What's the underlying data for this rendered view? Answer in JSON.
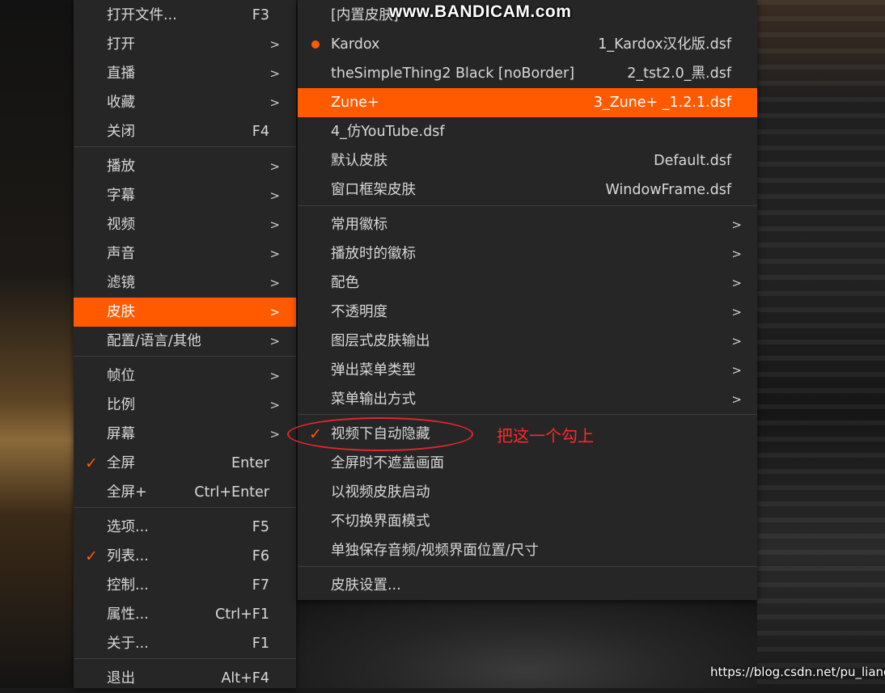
{
  "main_menu": {
    "items": [
      {
        "label": "打开文件...",
        "accel": "F3",
        "arrow": ""
      },
      {
        "label": "打开",
        "accel": "",
        "arrow": ">"
      },
      {
        "label": "直播",
        "accel": "",
        "arrow": ">"
      },
      {
        "label": "收藏",
        "accel": "",
        "arrow": ">"
      },
      {
        "label": "关闭",
        "accel": "F4",
        "arrow": ""
      },
      {
        "label": "播放",
        "accel": "",
        "arrow": ">"
      },
      {
        "label": "字幕",
        "accel": "",
        "arrow": ">"
      },
      {
        "label": "视频",
        "accel": "",
        "arrow": ">"
      },
      {
        "label": "声音",
        "accel": "",
        "arrow": ">"
      },
      {
        "label": "滤镜",
        "accel": "",
        "arrow": ">"
      },
      {
        "label": "皮肤",
        "accel": "",
        "arrow": ">",
        "active": true
      },
      {
        "label": "配置/语言/其他",
        "accel": "",
        "arrow": ">"
      },
      {
        "label": "帧位",
        "accel": "",
        "arrow": ">"
      },
      {
        "label": "比例",
        "accel": "",
        "arrow": ">"
      },
      {
        "label": "屏幕",
        "accel": "",
        "arrow": ">"
      },
      {
        "label": "全屏",
        "accel": "Enter",
        "arrow": "",
        "checked": true,
        "check_mark": "✓"
      },
      {
        "label": "全屏+",
        "accel": "Ctrl+Enter",
        "arrow": ""
      },
      {
        "label": "选项...",
        "accel": "F5",
        "arrow": ""
      },
      {
        "label": "列表...",
        "accel": "F6",
        "arrow": "",
        "checked": true,
        "check_mark": "✓"
      },
      {
        "label": "控制...",
        "accel": "F7",
        "arrow": ""
      },
      {
        "label": "属性...",
        "accel": "Ctrl+F1",
        "arrow": ""
      },
      {
        "label": "关于...",
        "accel": "F1",
        "arrow": ""
      },
      {
        "label": "退出",
        "accel": "Alt+F4",
        "arrow": ""
      }
    ]
  },
  "skin_menu": {
    "items": [
      {
        "label": "[内置皮肤]",
        "accel": "",
        "arrow": ""
      },
      {
        "label": "Kardox",
        "accel": "1_Kardox汉化版.dsf",
        "arrow": "",
        "dot": true
      },
      {
        "label": "theSimpleThing2 Black [noBorder]",
        "accel": "2_tst2.0_黑.dsf",
        "arrow": ""
      },
      {
        "label": "Zune+",
        "accel": "3_Zune+ _1.2.1.dsf",
        "arrow": "",
        "active": true
      },
      {
        "label": "4_仿YouTube.dsf",
        "accel": "",
        "arrow": ""
      },
      {
        "label": "默认皮肤",
        "accel": "Default.dsf",
        "arrow": ""
      },
      {
        "label": "窗口框架皮肤",
        "accel": "WindowFrame.dsf",
        "arrow": ""
      },
      {
        "label": "常用徽标",
        "accel": "",
        "arrow": ">"
      },
      {
        "label": "播放时的徽标",
        "accel": "",
        "arrow": ">"
      },
      {
        "label": "配色",
        "accel": "",
        "arrow": ">"
      },
      {
        "label": "不透明度",
        "accel": "",
        "arrow": ">"
      },
      {
        "label": "图层式皮肤输出",
        "accel": "",
        "arrow": ">"
      },
      {
        "label": "弹出菜单类型",
        "accel": "",
        "arrow": ">"
      },
      {
        "label": "菜单输出方式",
        "accel": "",
        "arrow": ">"
      },
      {
        "label": "视频下自动隐藏",
        "accel": "",
        "arrow": "",
        "checked": true,
        "check_mark": "✓"
      },
      {
        "label": "全屏时不遮盖画面",
        "accel": "",
        "arrow": ""
      },
      {
        "label": "以视频皮肤启动",
        "accel": "",
        "arrow": ""
      },
      {
        "label": "不切换界面模式",
        "accel": "",
        "arrow": ""
      },
      {
        "label": "单独保存音频/视频界面位置/尺寸",
        "accel": "",
        "arrow": ""
      },
      {
        "label": "皮肤设置...",
        "accel": "",
        "arrow": ""
      }
    ]
  },
  "overlay": {
    "watermark": "www.BANDICAM.com",
    "annotation": "把这一个勾上",
    "url": "https://blog.csdn.net/pu_liang"
  },
  "colors": {
    "accent": "#ff5a00",
    "menu_bg": "#262626",
    "annotation": "#e3262e"
  }
}
